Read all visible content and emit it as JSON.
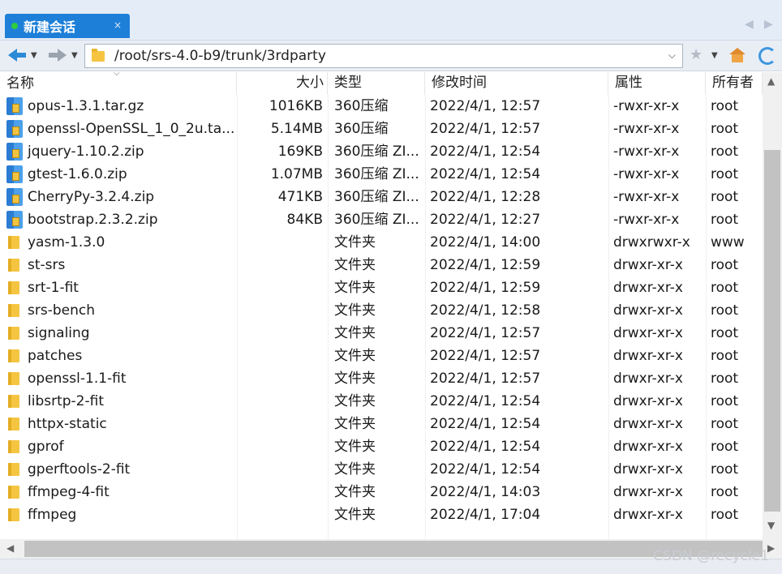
{
  "tab": {
    "title": "新建会话",
    "close": "×",
    "status_color": "#2ecc40",
    "accent": "#1e7fd8"
  },
  "toolbar": {
    "path": "/root/srs-4.0-b9/trunk/3rdparty",
    "back_icon": "back-arrow-icon",
    "forward_icon": "forward-arrow-icon"
  },
  "columns": {
    "name": "名称",
    "size": "大小",
    "type": "类型",
    "modified": "修改时间",
    "attributes": "属性",
    "owner": "所有者"
  },
  "files": [
    {
      "name": "opus-1.3.1.tar.gz",
      "size": "1016KB",
      "type": "360压缩",
      "modified": "2022/4/1, 12:57",
      "attr": "-rwxr-xr-x",
      "owner": "root",
      "icon": "archive-icon"
    },
    {
      "name": "openssl-OpenSSL_1_0_2u.ta...",
      "size": "5.14MB",
      "type": "360压缩",
      "modified": "2022/4/1, 12:57",
      "attr": "-rwxr-xr-x",
      "owner": "root",
      "icon": "archive-icon"
    },
    {
      "name": "jquery-1.10.2.zip",
      "size": "169KB",
      "type": "360压缩 ZI...",
      "modified": "2022/4/1, 12:54",
      "attr": "-rwxr-xr-x",
      "owner": "root",
      "icon": "archive-icon"
    },
    {
      "name": "gtest-1.6.0.zip",
      "size": "1.07MB",
      "type": "360压缩 ZI...",
      "modified": "2022/4/1, 12:54",
      "attr": "-rwxr-xr-x",
      "owner": "root",
      "icon": "archive-icon"
    },
    {
      "name": "CherryPy-3.2.4.zip",
      "size": "471KB",
      "type": "360压缩 ZI...",
      "modified": "2022/4/1, 12:28",
      "attr": "-rwxr-xr-x",
      "owner": "root",
      "icon": "archive-icon"
    },
    {
      "name": "bootstrap.2.3.2.zip",
      "size": "84KB",
      "type": "360压缩 ZI...",
      "modified": "2022/4/1, 12:27",
      "attr": "-rwxr-xr-x",
      "owner": "root",
      "icon": "archive-icon"
    },
    {
      "name": "yasm-1.3.0",
      "size": "",
      "type": "文件夹",
      "modified": "2022/4/1, 14:00",
      "attr": "drwxrwxr-x",
      "owner": "www",
      "icon": "folder-icon"
    },
    {
      "name": "st-srs",
      "size": "",
      "type": "文件夹",
      "modified": "2022/4/1, 12:59",
      "attr": "drwxr-xr-x",
      "owner": "root",
      "icon": "folder-icon"
    },
    {
      "name": "srt-1-fit",
      "size": "",
      "type": "文件夹",
      "modified": "2022/4/1, 12:59",
      "attr": "drwxr-xr-x",
      "owner": "root",
      "icon": "folder-icon"
    },
    {
      "name": "srs-bench",
      "size": "",
      "type": "文件夹",
      "modified": "2022/4/1, 12:58",
      "attr": "drwxr-xr-x",
      "owner": "root",
      "icon": "folder-icon"
    },
    {
      "name": "signaling",
      "size": "",
      "type": "文件夹",
      "modified": "2022/4/1, 12:57",
      "attr": "drwxr-xr-x",
      "owner": "root",
      "icon": "folder-icon"
    },
    {
      "name": "patches",
      "size": "",
      "type": "文件夹",
      "modified": "2022/4/1, 12:57",
      "attr": "drwxr-xr-x",
      "owner": "root",
      "icon": "folder-icon"
    },
    {
      "name": "openssl-1.1-fit",
      "size": "",
      "type": "文件夹",
      "modified": "2022/4/1, 12:57",
      "attr": "drwxr-xr-x",
      "owner": "root",
      "icon": "folder-icon"
    },
    {
      "name": "libsrtp-2-fit",
      "size": "",
      "type": "文件夹",
      "modified": "2022/4/1, 12:54",
      "attr": "drwxr-xr-x",
      "owner": "root",
      "icon": "folder-icon"
    },
    {
      "name": "httpx-static",
      "size": "",
      "type": "文件夹",
      "modified": "2022/4/1, 12:54",
      "attr": "drwxr-xr-x",
      "owner": "root",
      "icon": "folder-icon"
    },
    {
      "name": "gprof",
      "size": "",
      "type": "文件夹",
      "modified": "2022/4/1, 12:54",
      "attr": "drwxr-xr-x",
      "owner": "root",
      "icon": "folder-icon"
    },
    {
      "name": "gperftools-2-fit",
      "size": "",
      "type": "文件夹",
      "modified": "2022/4/1, 12:54",
      "attr": "drwxr-xr-x",
      "owner": "root",
      "icon": "folder-icon"
    },
    {
      "name": "ffmpeg-4-fit",
      "size": "",
      "type": "文件夹",
      "modified": "2022/4/1, 14:03",
      "attr": "drwxr-xr-x",
      "owner": "root",
      "icon": "folder-icon"
    },
    {
      "name": "ffmpeg",
      "size": "",
      "type": "文件夹",
      "modified": "2022/4/1, 17:04",
      "attr": "drwxr-xr-x",
      "owner": "root",
      "icon": "folder-icon"
    }
  ],
  "watermark": "CSDN @recycle1"
}
